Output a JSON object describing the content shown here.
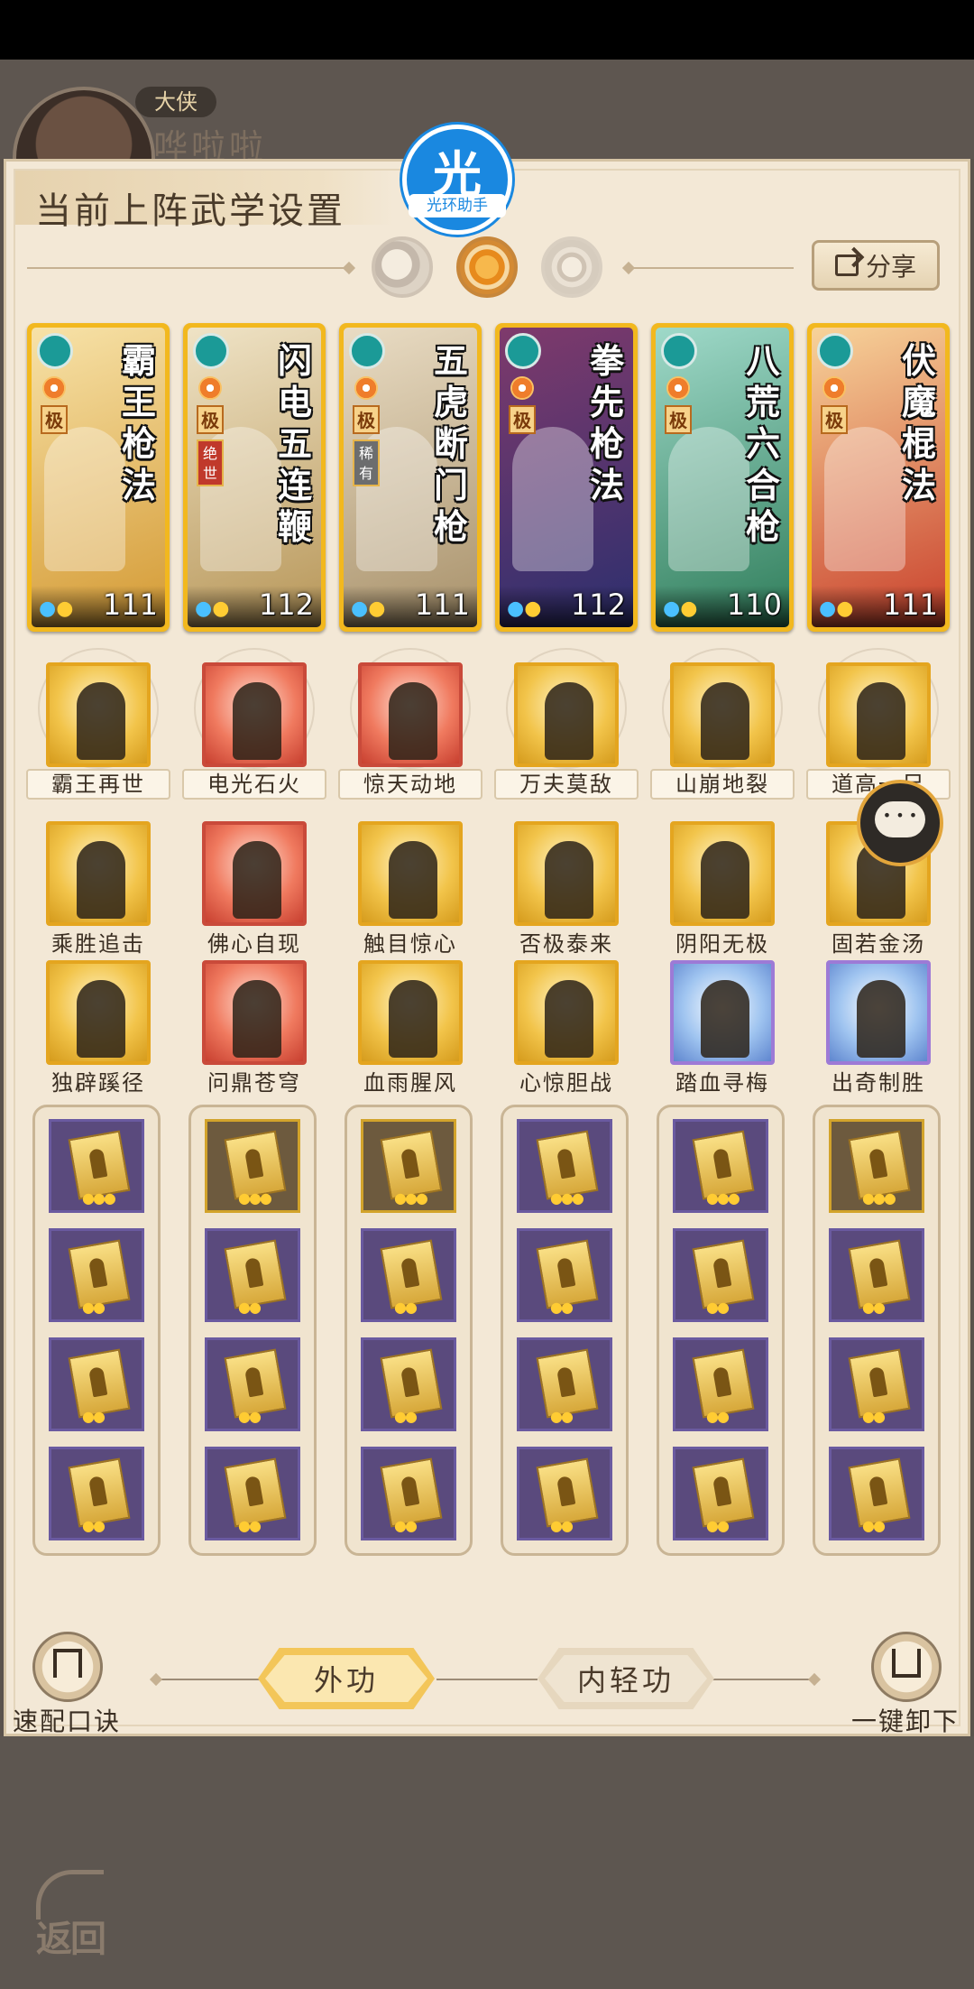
{
  "hero": {
    "tag": "大侠",
    "name": "哗啦啦"
  },
  "panel": {
    "title": "当前上阵武学设置",
    "share_label": "分享"
  },
  "assistant": {
    "char": "光",
    "label": "光环助手"
  },
  "phases": [
    "moon",
    "sun",
    "ring"
  ],
  "cards": [
    {
      "title": "霸王枪法",
      "tier": "极",
      "rarity": "",
      "level": "111",
      "colors": [
        "#f7e2a8",
        "#d49a34"
      ]
    },
    {
      "title": "闪电五连鞭",
      "tier": "极",
      "rarity": "绝世",
      "level": "112",
      "colors": [
        "#efe3c6",
        "#b79658"
      ]
    },
    {
      "title": "五虎断门枪",
      "tier": "极",
      "rarity": "稀有",
      "level": "111",
      "colors": [
        "#e9dcc4",
        "#a8916a"
      ]
    },
    {
      "title": "拳先枪法",
      "tier": "极",
      "rarity": "",
      "level": "112",
      "colors": [
        "#7f3a6c",
        "#2c2f6f"
      ]
    },
    {
      "title": "八荒六合枪",
      "tier": "极",
      "rarity": "",
      "level": "110",
      "colors": [
        "#9fd9c9",
        "#2f7d5a"
      ]
    },
    {
      "title": "伏魔棍法",
      "tier": "极",
      "rarity": "",
      "level": "111",
      "colors": [
        "#f7d39a",
        "#c9402b"
      ]
    }
  ],
  "ultimates": [
    "霸王再世",
    "电光石火",
    "惊天动地",
    "万夫莫敌",
    "山崩地裂",
    "道高一尺"
  ],
  "passives_row1": [
    "乘胜追击",
    "佛心自现",
    "触目惊心",
    "否极泰来",
    "阴阳无极",
    "固若金汤"
  ],
  "passives_row2": [
    "独辟蹊径",
    "问鼎苍穹",
    "血雨腥风",
    "心惊胆战",
    "踏血寻梅",
    "出奇制胜"
  ],
  "footer": {
    "quick_label": "速配口诀",
    "unequip_label": "一键卸下",
    "tab_outer": "外功",
    "tab_inner": "内轻功",
    "back_label": "返回"
  },
  "icons": {
    "share": "share-icon",
    "chat": "chat-bubble-icon",
    "upload": "upload-arrow-icon",
    "download": "download-arrow-icon",
    "back": "back-arrow-icon"
  },
  "colors": {
    "gold_frame": "#f2b81e",
    "panel_bg": "#f3e8d6",
    "assistant_blue": "#1a88e0"
  }
}
